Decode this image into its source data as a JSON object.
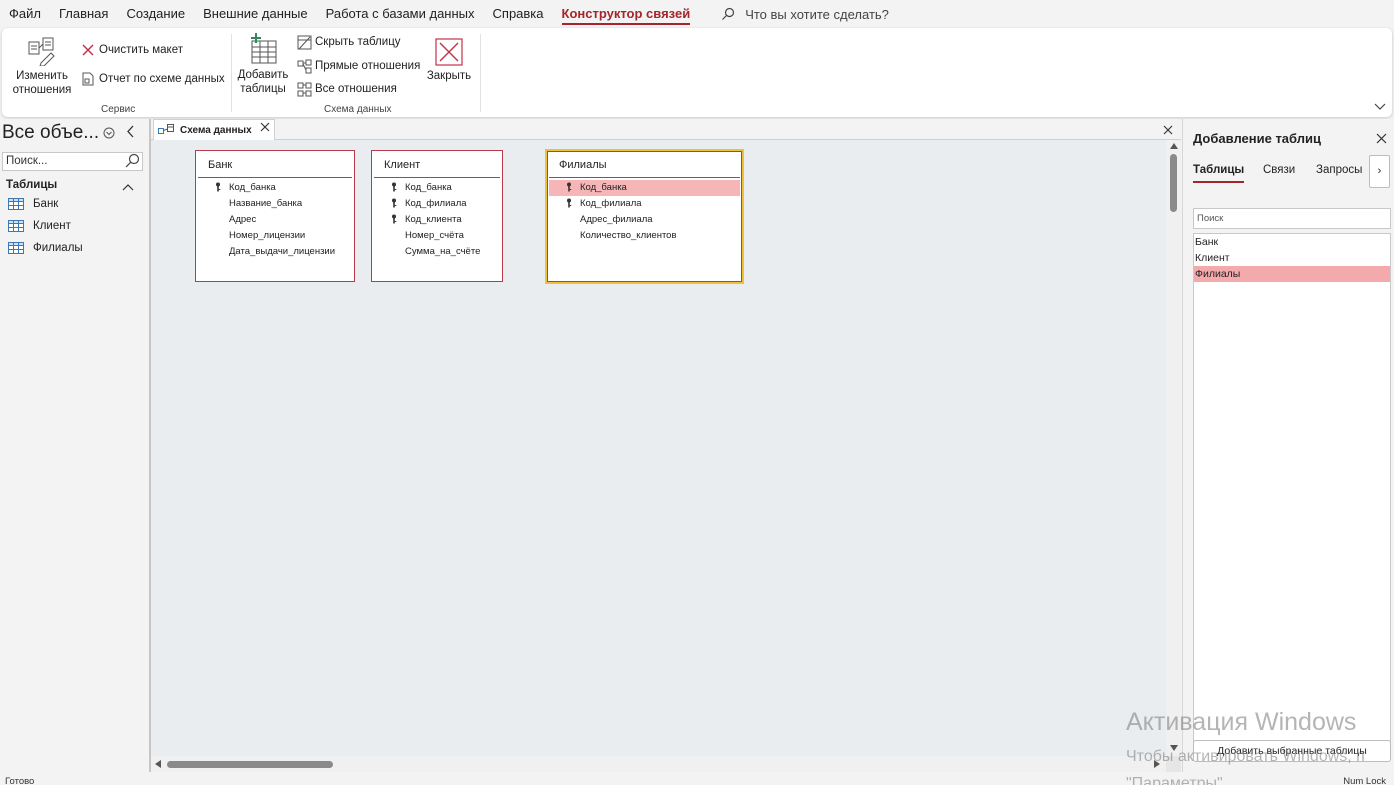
{
  "menu": {
    "tabs": [
      "Файл",
      "Главная",
      "Создание",
      "Внешние данные",
      "Работа с базами данных",
      "Справка",
      "Конструктор связей"
    ],
    "active_tab": "Конструктор связей",
    "tell_me": "Что вы хотите сделать?"
  },
  "ribbon": {
    "service": {
      "edit_relationships": "Изменить отношения",
      "clear_layout": "Очистить макет",
      "relationship_report": "Отчет по схеме данных",
      "group_label": "Сервис"
    },
    "schema": {
      "add_tables": "Добавить таблицы",
      "hide_table": "Скрыть таблицу",
      "direct_relationships": "Прямые отношения",
      "all_relationships": "Все отношения",
      "close": "Закрыть",
      "group_label": "Схема данных"
    }
  },
  "nav": {
    "title": "Все объе...",
    "search_placeholder": "Поиск...",
    "group": "Таблицы",
    "items": [
      "Банк",
      "Клиент",
      "Филиалы"
    ]
  },
  "document": {
    "tab_label": "Схема данных",
    "tables": [
      {
        "name": "Банк",
        "fields": [
          {
            "name": "Код_банка",
            "key": true
          },
          {
            "name": "Название_банка",
            "key": false
          },
          {
            "name": "Адрес",
            "key": false
          },
          {
            "name": "Номер_лицензии",
            "key": false
          },
          {
            "name": "Дата_выдачи_лицензии",
            "key": false
          }
        ]
      },
      {
        "name": "Клиент",
        "fields": [
          {
            "name": "Код_банка",
            "key": true
          },
          {
            "name": "Код_филиала",
            "key": true
          },
          {
            "name": "Код_клиента",
            "key": true
          },
          {
            "name": "Номер_счёта",
            "key": false
          },
          {
            "name": "Сумма_на_счёте",
            "key": false
          }
        ]
      },
      {
        "name": "Филиалы",
        "selected": true,
        "fields": [
          {
            "name": "Код_банка",
            "key": true,
            "highlighted": true
          },
          {
            "name": "Код_филиала",
            "key": true
          },
          {
            "name": "Адрес_филиала",
            "key": false
          },
          {
            "name": "Количество_клиентов",
            "key": false
          }
        ]
      }
    ]
  },
  "add_tables_pane": {
    "title": "Добавление таблиц",
    "tabs": [
      "Таблицы",
      "Связи",
      "Запросы"
    ],
    "active_tab": "Таблицы",
    "more": "›",
    "search_placeholder": "Поиск",
    "list": [
      "Банк",
      "Клиент",
      "Филиалы"
    ],
    "selected": "Филиалы",
    "add_button": "Добавить выбранные таблицы"
  },
  "status": {
    "left": "Готово",
    "right": "Num Lock"
  },
  "watermark": {
    "title": "Активация Windows",
    "line1": "Чтобы активировать Windows, п",
    "line2": "\"Параметры\"."
  },
  "colors": {
    "accent": "#a4262c",
    "selection": "#f0c039",
    "highlight": "#f6b6b8"
  }
}
